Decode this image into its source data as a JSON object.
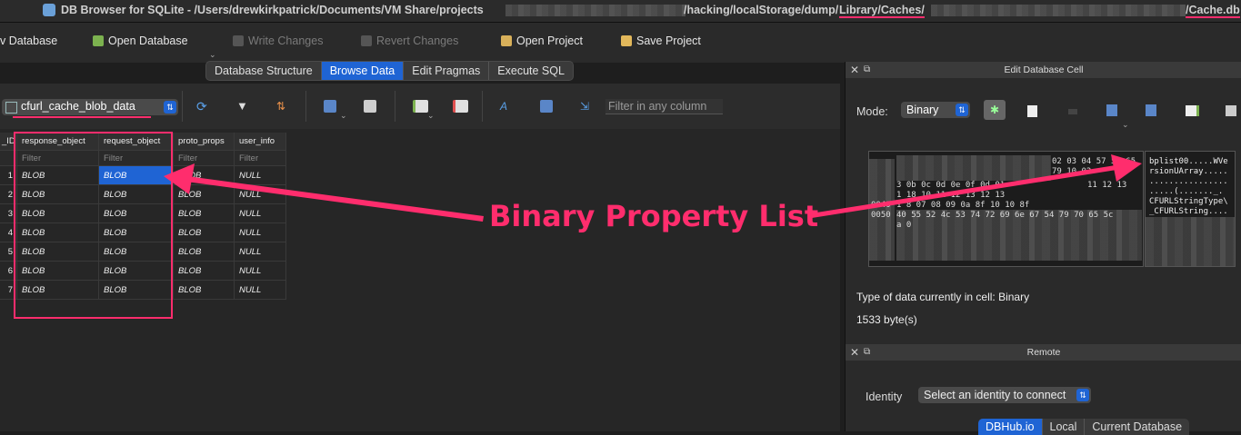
{
  "titlebar": {
    "title_prefix": "DB Browser for SQLite - /Users/drewkirkpatrick/Documents/VM Share/projects",
    "title_middle": "/hacking/localStorage/dump/",
    "title_lib": "Library/Caches/",
    "title_end": "/Cache.db"
  },
  "toolbar": {
    "new_db": "v Database",
    "open_db": "Open Database",
    "write_changes": "Write Changes",
    "revert_changes": "Revert Changes",
    "open_project": "Open Project",
    "save_project": "Save Project"
  },
  "tabs": [
    {
      "label": "Database Structure",
      "active": false
    },
    {
      "label": "Browse Data",
      "active": true
    },
    {
      "label": "Edit Pragmas",
      "active": false
    },
    {
      "label": "Execute SQL",
      "active": false
    }
  ],
  "browse": {
    "table_name": "cfurl_cache_blob_data",
    "filter_placeholder": "Filter in any column",
    "columns": [
      "_ID",
      "response_object",
      "request_object",
      "proto_props",
      "user_info"
    ],
    "filter_label": "Filter",
    "rows": [
      {
        "id": "1",
        "response_object": "BLOB",
        "request_object": "BLOB",
        "proto_props": "BLOB",
        "user_info": "NULL"
      },
      {
        "id": "2",
        "response_object": "BLOB",
        "request_object": "BLOB",
        "proto_props": "BLOB",
        "user_info": "NULL"
      },
      {
        "id": "3",
        "response_object": "BLOB",
        "request_object": "BLOB",
        "proto_props": "BLOB",
        "user_info": "NULL"
      },
      {
        "id": "4",
        "response_object": "BLOB",
        "request_object": "BLOB",
        "proto_props": "BLOB",
        "user_info": "NULL"
      },
      {
        "id": "5",
        "response_object": "BLOB",
        "request_object": "BLOB",
        "proto_props": "BLOB",
        "user_info": "NULL"
      },
      {
        "id": "6",
        "response_object": "BLOB",
        "request_object": "BLOB",
        "proto_props": "BLOB",
        "user_info": "NULL"
      },
      {
        "id": "7",
        "response_object": "BLOB",
        "request_object": "BLOB",
        "proto_props": "BLOB",
        "user_info": "NULL"
      }
    ]
  },
  "edit_cell": {
    "title": "Edit Database Cell",
    "mode_label": "Mode:",
    "mode_value": "Binary",
    "hex_lines": [
      "02 03 04 57 56 65",
      "79 10 02 ",
      "3 0b 0c 0d 0e 0f 0d 01",
      "11 12 13",
      "1 18 10 11 12 13 12 13",
      "1 8 07 08 09 0a 8f 10 10 8f",
      "40 55 52 4c 53 74 72 69 6e 67 54 79 70 65 5c",
      "a 0"
    ],
    "hex_offsets": [
      "0040",
      "0050"
    ],
    "ascii_lines": [
      "bplist00.....WVe",
      "rsionUArray.....",
      "................",
      ".....(......._.",
      "CFURLStringType\\",
      "_CFURLString...."
    ],
    "type_info": "Type of data currently in cell: Binary",
    "size_info": "1533 byte(s)"
  },
  "remote": {
    "title": "Remote",
    "identity_label": "Identity",
    "identity_value": "Select an identity to connect",
    "tabs": [
      "DBHub.io",
      "Local",
      "Current Database"
    ]
  },
  "annotation": {
    "text": "Binary Property List",
    "color": "#ff2d6d"
  }
}
